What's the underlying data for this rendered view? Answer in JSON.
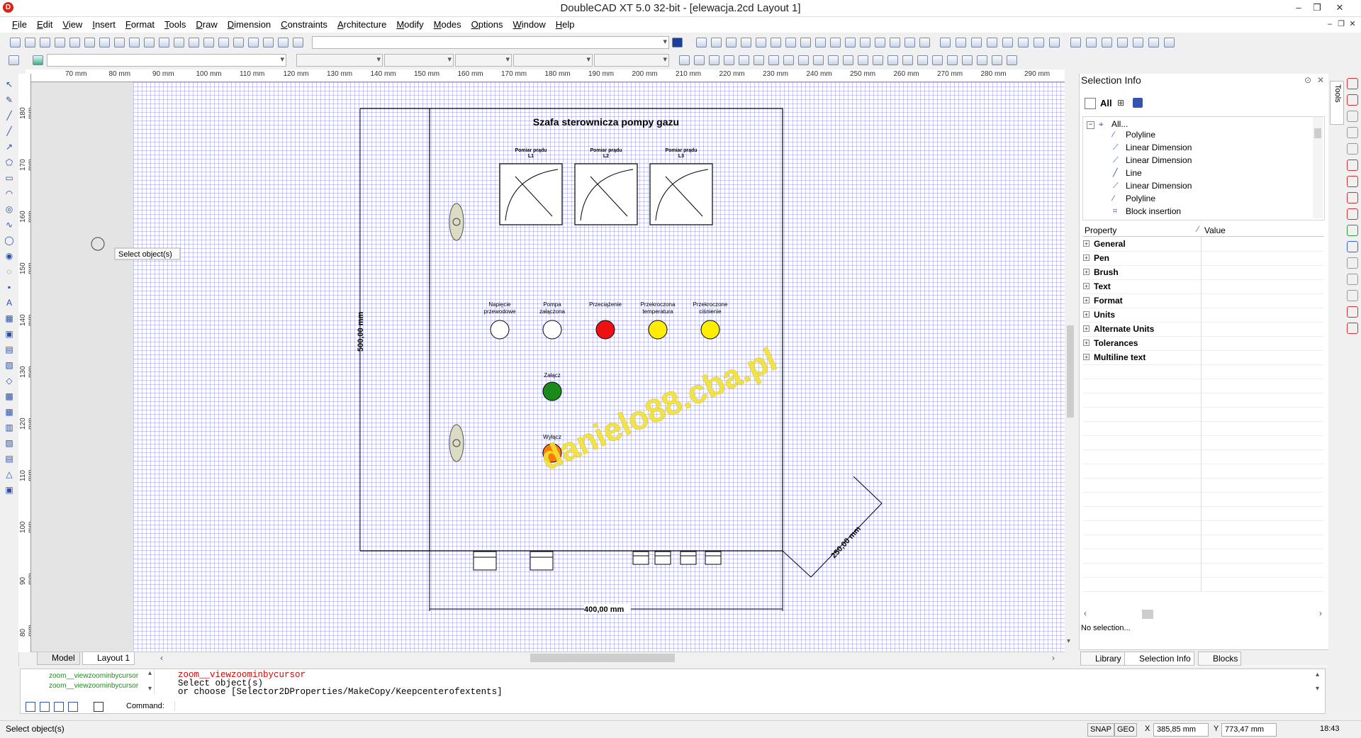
{
  "window": {
    "title": "DoubleCAD XT 5.0 32-bit - [elewacja.2cd Layout 1]",
    "app_icon_letter": "D",
    "controls": {
      "minimize": "–",
      "restore": "❐",
      "close": "✕"
    }
  },
  "menu": [
    "File",
    "Edit",
    "View",
    "Insert",
    "Format",
    "Tools",
    "Draw",
    "Dimension",
    "Constraints",
    "Architecture",
    "Modify",
    "Modes",
    "Options",
    "Window",
    "Help"
  ],
  "mdi_controls": {
    "minimize": "–",
    "restore": "❐",
    "close": "✕"
  },
  "rulers": {
    "horizontal": [
      "70 mm",
      "80 mm",
      "90 mm",
      "100 mm",
      "110 mm",
      "120 mm",
      "130 mm",
      "140 mm",
      "150 mm",
      "160 mm",
      "170 mm",
      "180 mm",
      "190 mm",
      "200 mm",
      "210 mm",
      "220 mm",
      "230 mm",
      "240 mm",
      "250 mm",
      "260 mm",
      "270 mm",
      "280 mm",
      "290 mm"
    ],
    "vertical": [
      "180 mm",
      "170 mm",
      "160 mm",
      "150 mm",
      "140 mm",
      "130 mm",
      "120 mm",
      "110 mm",
      "100 mm",
      "90 mm",
      "80 mm"
    ]
  },
  "drawing": {
    "title": "Szafa sterownicza pompy gazu",
    "meters": [
      {
        "label_line1": "Pomiar prądu",
        "label_line2": "L1"
      },
      {
        "label_line1": "Pomiar prądu",
        "label_line2": "L2"
      },
      {
        "label_line1": "Pomiar prądu",
        "label_line2": "L3"
      }
    ],
    "lamps": [
      {
        "label_line1": "Napięcie",
        "label_line2": "przewodowe",
        "color": "#ffffff"
      },
      {
        "label_line1": "Pompa",
        "label_line2": "załączona",
        "color": "#ffffff"
      },
      {
        "label_line1": "Przeciążenie",
        "label_line2": "",
        "color": "#ee1111"
      },
      {
        "label_line1": "Przekroczona",
        "label_line2": "temperatura",
        "color": "#ffee00"
      },
      {
        "label_line1": "Przekroczone",
        "label_line2": "ciśnienie",
        "color": "#ffee00"
      }
    ],
    "buttons": [
      {
        "label": "Załącz",
        "color": "#1a8a1a"
      },
      {
        "label": "Wyłącz",
        "color": "#ff7a00"
      }
    ],
    "dimensions": {
      "height": "500,00 mm",
      "width": "400,00 mm",
      "depth": "250,00 mm"
    },
    "watermark": "danielo88.cba.pl",
    "tooltip": "Select object(s)"
  },
  "layout_tabs": [
    {
      "label": "Model",
      "active": false
    },
    {
      "label": "Layout 1",
      "active": true
    }
  ],
  "panel": {
    "title": "Selection Info",
    "filter_all": "All",
    "tree_root": "All...",
    "tree_items": [
      {
        "label": "Polyline",
        "icon": "polyline-icon"
      },
      {
        "label": "Linear Dimension",
        "icon": "linear-dimension-icon"
      },
      {
        "label": "Linear Dimension",
        "icon": "linear-dimension-icon"
      },
      {
        "label": "Line",
        "icon": "line-icon"
      },
      {
        "label": "Linear Dimension",
        "icon": "linear-dimension-icon"
      },
      {
        "label": "Polyline",
        "icon": "polyline-icon"
      },
      {
        "label": "Block insertion",
        "icon": "block-icon"
      }
    ],
    "property_header": {
      "property": "Property",
      "value": "Value"
    },
    "properties": [
      "General",
      "Pen",
      "Brush",
      "Text",
      "Format",
      "Units",
      "Alternate Units",
      "Tolerances",
      "Multiline text"
    ],
    "status": "No selection...",
    "tabs": [
      {
        "label": "Library",
        "active": false
      },
      {
        "label": "Selection Info",
        "active": true
      },
      {
        "label": "Blocks",
        "active": false
      }
    ],
    "side_tab": "Tools"
  },
  "command": {
    "history": [
      "zoom__viewzoominbycursor",
      "zoom__viewzoominbycursor"
    ],
    "output_line1": "zoom__viewzoominbycursor",
    "output_line2": "Select object(s)",
    "output_line3": "  or choose [Selector2DProperties/MakeCopy/Keepcenterofextents]",
    "input_label": "Command:",
    "input_value": ""
  },
  "statusbar": {
    "message": "Select object(s)",
    "snap": "SNAP",
    "geo": "GEO",
    "x": "385,85 mm",
    "y": "773,47 mm",
    "time": "18:43"
  }
}
